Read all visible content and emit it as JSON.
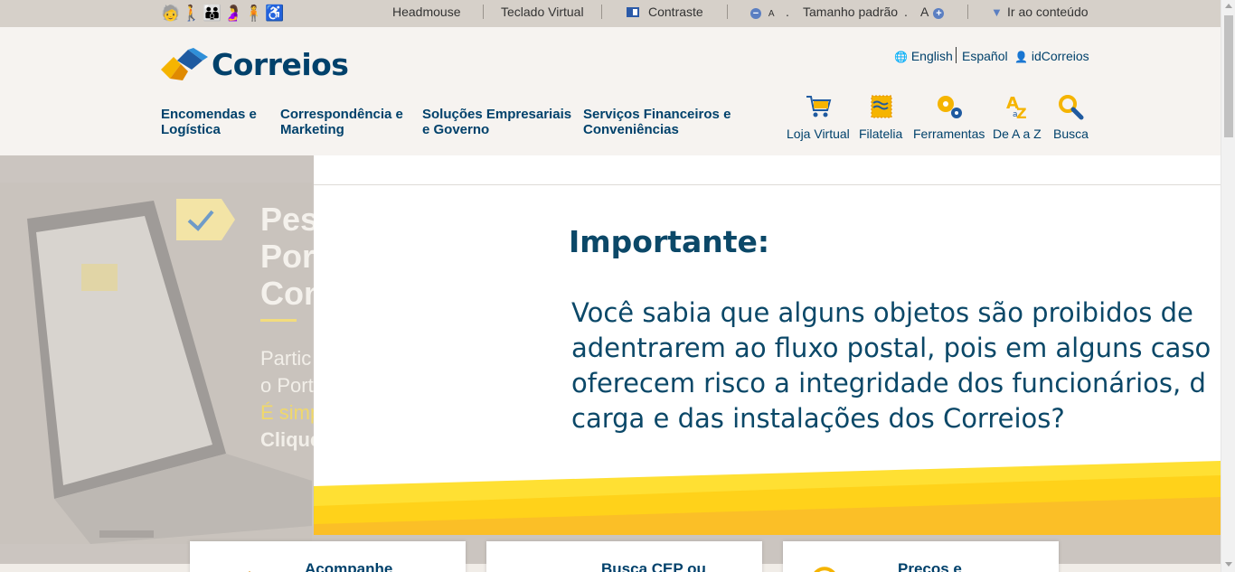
{
  "accessibility": {
    "headmouse": "Headmouse",
    "teclado_virtual": "Teclado Virtual",
    "contraste": "Contraste",
    "font_small": "A",
    "dot1": ".",
    "tamanho_padrao": "Tamanho padrão",
    "dot2": ".",
    "font_large": "A",
    "ir_ao_conteudo": "Ir ao conteúdo"
  },
  "header": {
    "logo_text": "Correios",
    "languages": {
      "english": "English",
      "espanol": "Español",
      "id_correios": "idCorreios"
    },
    "nav": [
      {
        "line1": "Encomendas e",
        "line2": "Logística"
      },
      {
        "line1": "Correspondência e",
        "line2": "Marketing"
      },
      {
        "line1": "Soluções Empresariais",
        "line2": "e Governo"
      },
      {
        "line1": "Serviços Financeiros e",
        "line2": "Conveniências"
      }
    ],
    "tools": [
      {
        "label": "Loja Virtual",
        "icon": "cart-icon"
      },
      {
        "label": "Filatelia",
        "icon": "stamp-icon"
      },
      {
        "label": "Ferramentas",
        "icon": "gears-icon"
      },
      {
        "label": "De A a Z",
        "icon": "a-to-z-icon"
      },
      {
        "label": "Busca",
        "icon": "search-icon"
      }
    ]
  },
  "hero": {
    "title_lines": [
      "Pes",
      "Por",
      "Con"
    ],
    "sub_line1": "Partic",
    "sub_line2": "o Port",
    "sub_line3": "É simp",
    "sub_line4": "Clique"
  },
  "modal": {
    "title": "Importante:",
    "text_lines": [
      "Você sabia que alguns objetos são proibidos de",
      "adentrarem ao fluxo postal, pois em alguns caso",
      "oferecem risco a integridade dos funcionários, d",
      "carga e das instalações dos Correios?"
    ]
  },
  "cards": [
    {
      "title": "Acompanhe"
    },
    {
      "title": "Busca CEP ou"
    },
    {
      "title": "Preços e"
    }
  ],
  "colors": {
    "brand_blue": "#00416b",
    "brand_yellow": "#ffd400",
    "modal_text": "#0b4868"
  }
}
